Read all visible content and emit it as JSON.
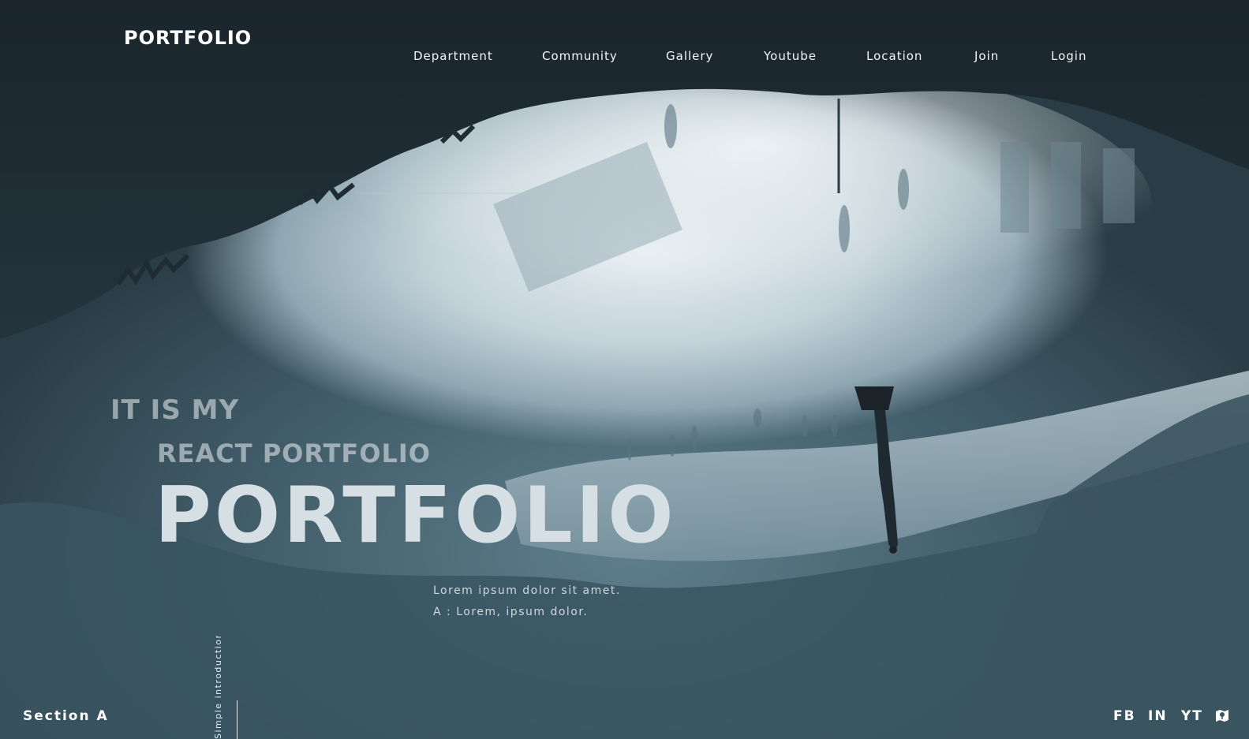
{
  "brand": "PORTFOLIO",
  "nav": {
    "items": [
      "Department",
      "Community",
      "Gallery",
      "Youtube",
      "Location",
      "Join",
      "Login"
    ]
  },
  "hero": {
    "line1": "IT IS MY",
    "line2": "REACT PORTFOLIO",
    "big": "PORTFOLIO",
    "sub1": "Lorem ipsum dolor sit amet.",
    "sub2": "A : Lorem, ipsum dolor."
  },
  "footer": {
    "section_label": "Section A",
    "vertical_text": "Simple introduction",
    "socials": [
      "FB",
      "IN",
      "YT"
    ],
    "map_icon": "map-icon"
  }
}
